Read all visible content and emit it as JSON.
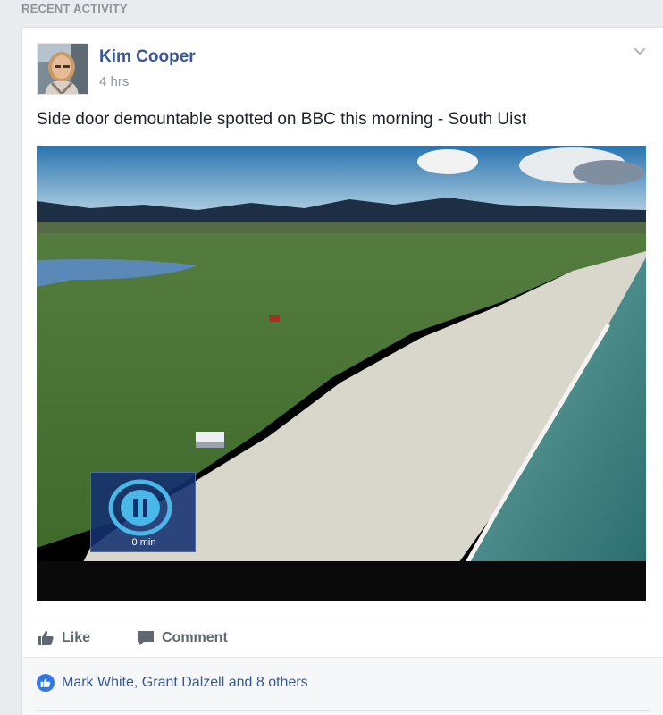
{
  "section": {
    "title": "RECENT ACTIVITY"
  },
  "post": {
    "author": "Kim Cooper",
    "timestamp": "4 hrs",
    "text": "Side door demountable spotted on BBC this morning - South Uist",
    "video_overlay": {
      "label": "0 min",
      "icon": "pause-icon"
    },
    "actions": {
      "like_label": "Like",
      "comment_label": "Comment"
    },
    "reactions_text": "Mark White, Grant Dalzell and 8 others"
  },
  "colors": {
    "link": "#365899",
    "muted": "#90949c",
    "action": "#606770",
    "like_badge": "#3578e5",
    "overlay": "#123070"
  }
}
